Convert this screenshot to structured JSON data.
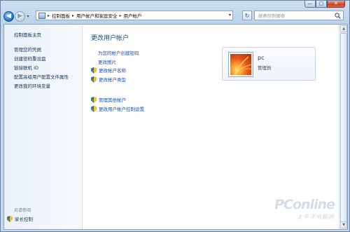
{
  "window": {
    "minimize_icon": "minimize-icon",
    "maximize_icon": "maximize-icon",
    "close_icon": "close-icon",
    "minimize_glyph": "—",
    "maximize_glyph": "□",
    "close_glyph": "✕"
  },
  "nav": {
    "back_glyph": "◀",
    "forward_glyph": "▶",
    "dropdown_glyph": "▾",
    "breadcrumbs": [
      "控制面板",
      "用户帐户和家庭安全",
      "用户帐户"
    ],
    "crumb_sep": "▸",
    "refresh_glyph": "↻",
    "search_placeholder": "搜索控制面板"
  },
  "sidebar": {
    "home": "控制面板主页",
    "items": [
      "管理您的凭据",
      "创建密码重设盘",
      "链接联机 ID",
      "配置高级用户配置文件属性",
      "更改我的环境变量"
    ],
    "see_also": "另请参阅",
    "parental_controls": "家长控制"
  },
  "main": {
    "title": "更改用户帐户",
    "links": [
      {
        "label": "为您的帐户创建密码",
        "shield": false
      },
      {
        "label": "更改图片",
        "shield": false
      },
      {
        "label": "更改帐户名称",
        "shield": true
      },
      {
        "label": "更改帐户类型",
        "shield": true
      }
    ],
    "links2": [
      {
        "label": "管理其他帐户",
        "shield": true
      },
      {
        "label": "更改用户帐户控制设置",
        "shield": true
      }
    ]
  },
  "user": {
    "name": "pc",
    "role": "管理员"
  },
  "watermark": {
    "brand": "PConline",
    "sub": "太平洋电脑网"
  },
  "colors": {
    "link": "#1a50b8",
    "title": "#1c4a7a"
  }
}
